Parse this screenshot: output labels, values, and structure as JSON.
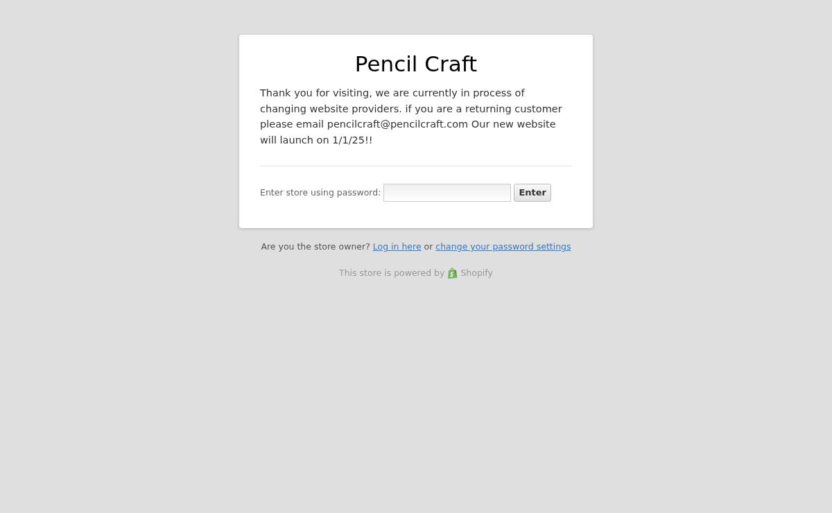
{
  "card": {
    "title": "Pencil Craft",
    "message": "Thank you for visiting, we are currently in process of changing website providers. if you are a returning customer please email pencilcraft@pencilcraft.com Our new website will launch on 1/1/25!!",
    "password_form": {
      "label": "Enter store using password:",
      "button": "Enter"
    }
  },
  "owner_line": {
    "text": "Are you the store owner?",
    "login_link": "Log in here",
    "middle": "or",
    "settings_link": "change your password settings"
  },
  "powered_by": {
    "text": "This store is powered by",
    "link": "Shopify"
  }
}
